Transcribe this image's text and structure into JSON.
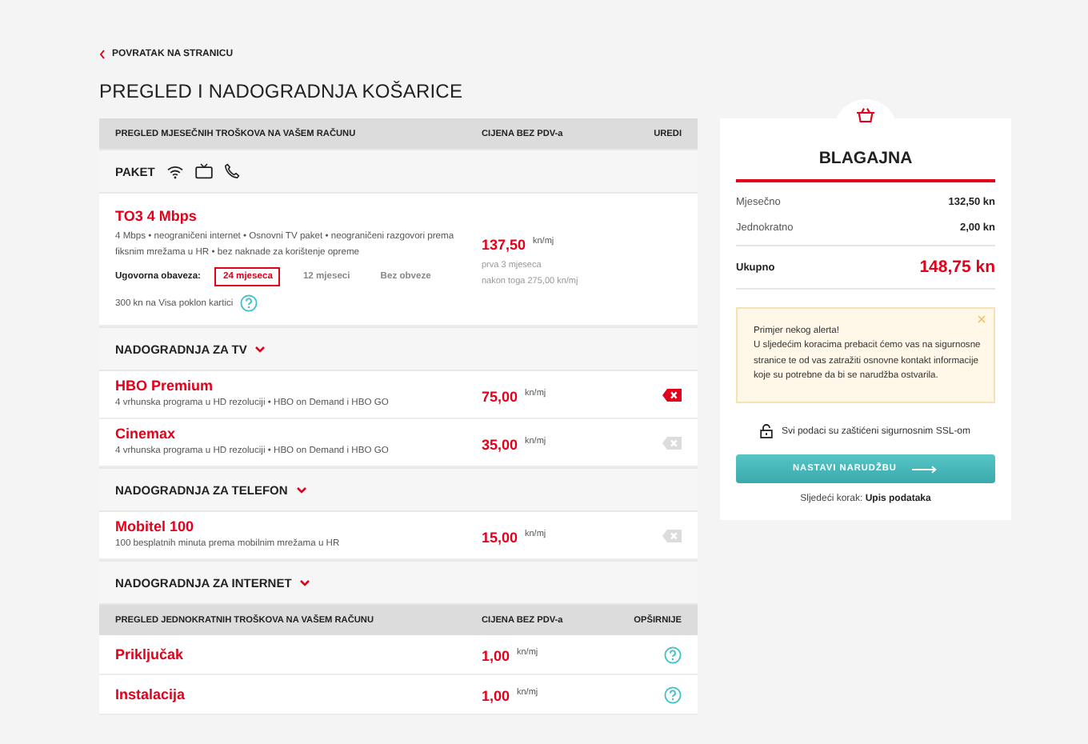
{
  "back_link": {
    "label": "POVRATAK NA STRANICU"
  },
  "page_title": "PREGLED I NADOGRADNJA KOŠARICE",
  "monthly_table": {
    "columns": [
      "PREGLED MJESEČNIH TROŠKOVA NA VAŠEM RAČUNU",
      "CIJENA BEZ PDV-a",
      "UREDI"
    ],
    "package": {
      "label": "PAKET",
      "name": "TO3 4 Mbps",
      "description": "4 Mbps • neograničeni internet • Osnovni TV paket • neograničeni razgovori prema fiksnim mrežama u HR • bez naknade za korištenje opreme",
      "price": "137,50",
      "unit": "kn/mj",
      "price_notes": [
        "prva 3 mjeseca",
        "nakon toga 275,00 kn/mj"
      ],
      "contract_label": "Ugovorna obaveza:",
      "contract_options": [
        {
          "label": "24 mjeseca",
          "selected": true
        },
        {
          "label": "12 mjeseci",
          "selected": false
        },
        {
          "label": "Bez obveze",
          "selected": false
        }
      ],
      "gift": "300 kn na Visa poklon kartici"
    },
    "sections": [
      {
        "title": "NADOGRADNJA ZA TV",
        "items": [
          {
            "name": "HBO Premium",
            "description": "4 vrhunska programa u HD rezoluciji • HBO on Demand i HBO GO",
            "price": "75,00",
            "unit": "kn/mj",
            "active": true
          },
          {
            "name": "Cinemax",
            "description": "4 vrhunska programa u HD rezoluciji • HBO on Demand i HBO GO",
            "price": "35,00",
            "unit": "kn/mj",
            "active": false
          }
        ]
      },
      {
        "title": "NADOGRADNJA ZA TELEFON",
        "items": [
          {
            "name": "Mobitel 100",
            "description": "100 besplatnih minuta prema mobilnim mrežama u HR",
            "price": "15,00",
            "unit": "kn/mj",
            "active": false
          }
        ]
      },
      {
        "title": "NADOGRADNJA ZA INTERNET"
      }
    ]
  },
  "one_time_table": {
    "columns": [
      "PREGLED JEDNOKRATNIH TROŠKOVA NA VAŠEM RAČUNU",
      "CIJENA BEZ PDV-a",
      "OPŠIRNIJE"
    ],
    "rows": [
      {
        "name": "Priključak",
        "price": "1,00",
        "unit": "kn/mj"
      },
      {
        "name": "Instalacija",
        "price": "1,00",
        "unit": "kn/mj"
      }
    ]
  },
  "checkout": {
    "title": "BLAGAJNA",
    "lines": [
      {
        "label": "Mjesečno",
        "value": "132,50 kn"
      },
      {
        "label": "Jednokratno",
        "value": "2,00 kn"
      }
    ],
    "total": {
      "label": "Ukupno",
      "value": "148,75 kn"
    },
    "alert": {
      "title": "Primjer nekog alerta!",
      "text": "U sljedećim koracima prebacit ćemo vas na sigurnosne stranice te od vas zatražiti osnovne kontakt informacije koje su potrebne da bi se narudžba ostvarila."
    },
    "security_note": "Svi podaci su zaštićeni sigurnosnim SSL-om",
    "button": "NASTAVI NARUDŽBU",
    "next_step": "Sljedeći korak: **Upis podataka**"
  }
}
